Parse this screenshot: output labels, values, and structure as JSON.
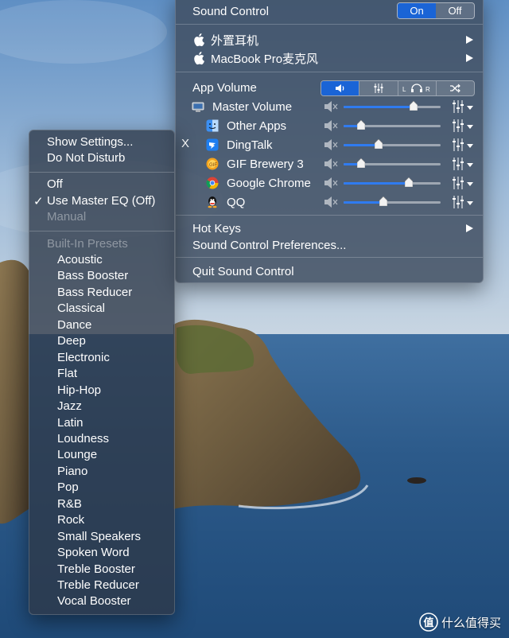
{
  "main_menu": {
    "title": "Sound Control",
    "toggle_on": "On",
    "toggle_off": "Off",
    "devices": [
      {
        "label": "外置耳机"
      },
      {
        "label": "MacBook Pro麦克风"
      }
    ],
    "app_volume_label": "App Volume",
    "apps": [
      {
        "label": "Master Volume",
        "icon": "display-icon",
        "level": 0.72,
        "color": "#2f7bf0"
      },
      {
        "label": "Other Apps",
        "icon": "finder-icon",
        "level": 0.18,
        "color": "#2f7bf0"
      },
      {
        "label": "DingTalk",
        "icon": "dingtalk-icon",
        "level": 0.36,
        "color": "#2f7bf0"
      },
      {
        "label": "GIF Brewery 3",
        "icon": "gif-brewery-icon",
        "level": 0.18,
        "color": "#2f7bf0"
      },
      {
        "label": "Google Chrome",
        "icon": "chrome-icon",
        "level": 0.67,
        "color": "#2f7bf0"
      },
      {
        "label": "QQ",
        "icon": "qq-penguin-icon",
        "level": 0.41,
        "color": "#2f7bf0"
      }
    ],
    "excluded_marker": "X",
    "hot_keys": "Hot Keys",
    "preferences": "Sound Control Preferences...",
    "quit": "Quit Sound Control"
  },
  "eq_menu": {
    "show_settings": "Show Settings...",
    "do_not_disturb": "Do Not Disturb",
    "off": "Off",
    "use_master_eq": "Use Master EQ (Off)",
    "checkmark": "✓",
    "manual": "Manual",
    "built_in_presets": "Built-In Presets",
    "presets": [
      "Acoustic",
      "Bass Booster",
      "Bass Reducer",
      "Classical",
      "Dance",
      "Deep",
      "Electronic",
      "Flat",
      "Hip-Hop",
      "Jazz",
      "Latin",
      "Loudness",
      "Lounge",
      "Piano",
      "Pop",
      "R&B",
      "Rock",
      "Small Speakers",
      "Spoken Word",
      "Treble Booster",
      "Treble Reducer",
      "Vocal Booster"
    ]
  },
  "watermark": {
    "text": "什么值得买"
  },
  "colors": {
    "accent": "#1a64d6",
    "slider": "#2f7bf0"
  }
}
